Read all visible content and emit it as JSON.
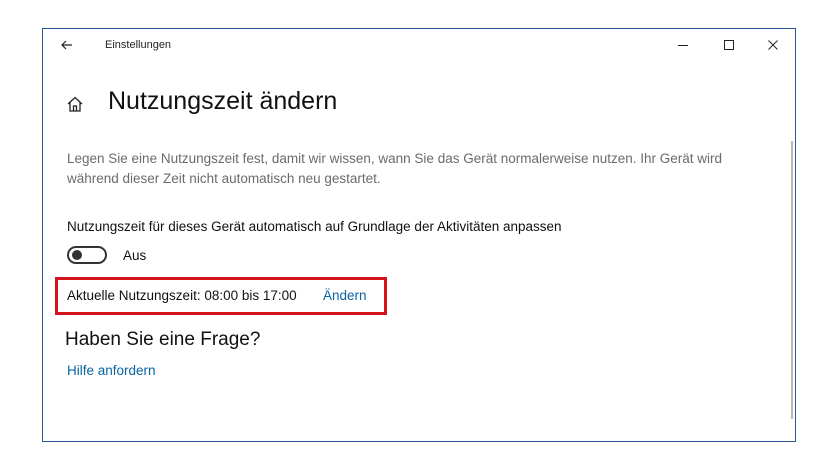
{
  "titlebar": {
    "app_title": "Einstellungen",
    "back_icon": "back-arrow-icon",
    "minimize_icon": "minimize-icon",
    "maximize_icon": "maximize-icon",
    "close_icon": "close-icon"
  },
  "page": {
    "home_icon": "home-icon",
    "title": "Nutzungszeit ändern",
    "description": "Legen Sie eine Nutzungszeit fest, damit wir wissen, wann Sie das Gerät normalerweise nutzen. Ihr Gerät wird während dieser Zeit nicht automatisch neu gestartet.",
    "auto_adjust_label": "Nutzungszeit für dieses Gerät automatisch auf Grundlage der Aktivitäten anpassen",
    "toggle_state": "Aus",
    "current_time": "Aktuelle Nutzungszeit: 08:00 bis 17:00",
    "change_link": "Ändern",
    "question_heading": "Haben Sie eine Frage?",
    "help_link": "Hilfe anfordern"
  },
  "colors": {
    "link": "#0a64a0",
    "highlight": "#d4141b",
    "window_border": "#2b5797"
  }
}
